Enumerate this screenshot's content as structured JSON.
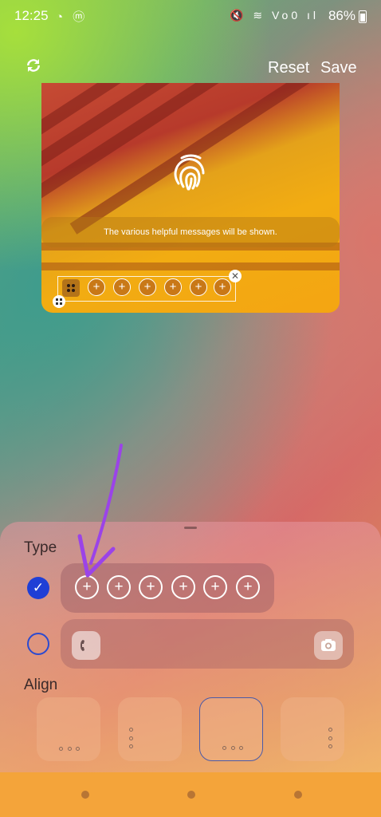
{
  "status": {
    "time": "12:25",
    "battery": "86%",
    "left_icons": "◔ ⓜ",
    "right_icons": "🔇 ≋ Vo0 ıl"
  },
  "header": {
    "reset_label": "Reset",
    "save_label": "Save"
  },
  "preview": {
    "message": "The various helpful messages will be shown.",
    "shortcut_plus": "+",
    "close_glyph": "✕"
  },
  "sheet": {
    "type_label": "Type",
    "align_label": "Align",
    "option1_check": "✓",
    "option1_plus": "+"
  },
  "colors": {
    "accent": "#1f3fd6",
    "arrow": "#9b43e8"
  }
}
